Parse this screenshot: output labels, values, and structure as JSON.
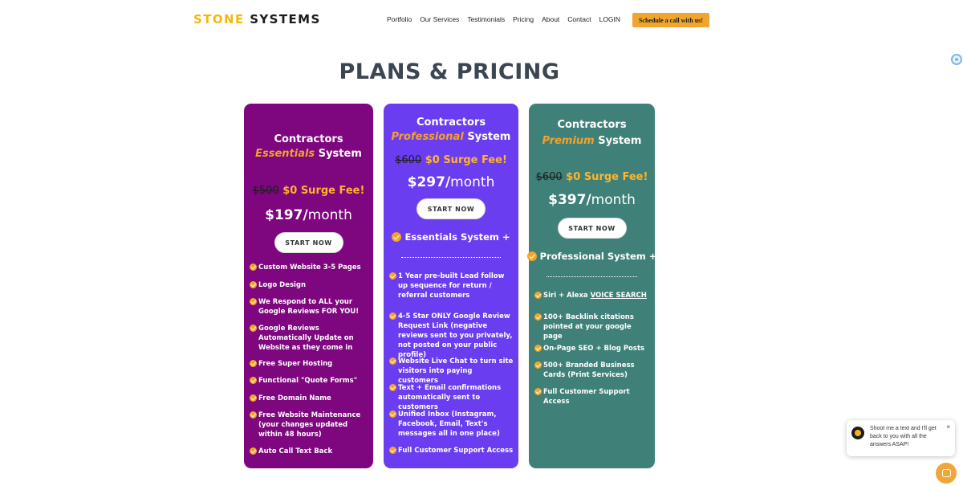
{
  "brand": {
    "part1": "STONE",
    "part2": "SYSTEMS"
  },
  "nav": [
    "Portfolio",
    "Our Services",
    "Testimonials",
    "Pricing",
    "About",
    "Contact",
    "LOGIN"
  ],
  "cta": "Schedule a call with us!",
  "page_title": "PLANS & PRICING",
  "plans": [
    {
      "title_line1": "Contractors",
      "title_emph": "Essentials",
      "title_rest": " System",
      "old_price": "$500",
      "surge": "$0 Surge Fee!",
      "price_amount": "$197/",
      "price_period": "month",
      "button": "START NOW",
      "features": [
        "Custom Website 3-5 Pages",
        "Logo Design",
        "We Respond to ALL your Google Reviews FOR YOU!",
        "Google Reviews Automatically Update on Website as they come in",
        "Free Super Hosting",
        "Functional \"Quote Forms\"",
        "Free Domain Name",
        "Free Website Maintenance (your changes updated within 48 hours)",
        "Auto Call Text Back"
      ]
    },
    {
      "title_line1": "Contractors",
      "title_emph": "Professional",
      "title_rest": " System",
      "old_price": "$600",
      "surge": "$0 Surge Fee!",
      "price_amount": "$297/",
      "price_period": "month",
      "button": "START NOW",
      "includes": "Essentials System +",
      "features": [
        "1 Year pre-built Lead follow up sequence for return / referral customers",
        "4-5 Star ONLY Google Review Request Link (negative reviews sent to you privately, not posted on your public profile)",
        "Website Live Chat to turn site visitors into paying customers",
        "Text + Email confirmations automatically sent to customers",
        "Unified Inbox (Instagram, Facebook, Email, Text's messages all in one place)",
        "Full Customer Support Access"
      ]
    },
    {
      "title_line1": "Contractors",
      "title_emph": "Premium",
      "title_rest": " System",
      "old_price": "$600",
      "surge": "$0 Surge Fee!",
      "price_amount": "$397/",
      "price_period": "month",
      "button": "START NOW",
      "includes": "Professional System +",
      "features_first_prefix": "Siri + Alexa ",
      "features_first_link": "VOICE SEARCH",
      "features": [
        "100+ Backlink citations pointed at your google page",
        "On-Page SEO + Blog Posts",
        "500+ Branded Business Cards (Print Services)",
        "Full Customer Support Access"
      ]
    }
  ],
  "chat": {
    "message": "Shoot me a text and I'll get back to you with all the answers ASAP!",
    "close": "×"
  },
  "colors": {
    "essentials": "#7e067e",
    "professional": "#6b3df0",
    "premium": "#3f8178",
    "accent": "#f5a524"
  }
}
